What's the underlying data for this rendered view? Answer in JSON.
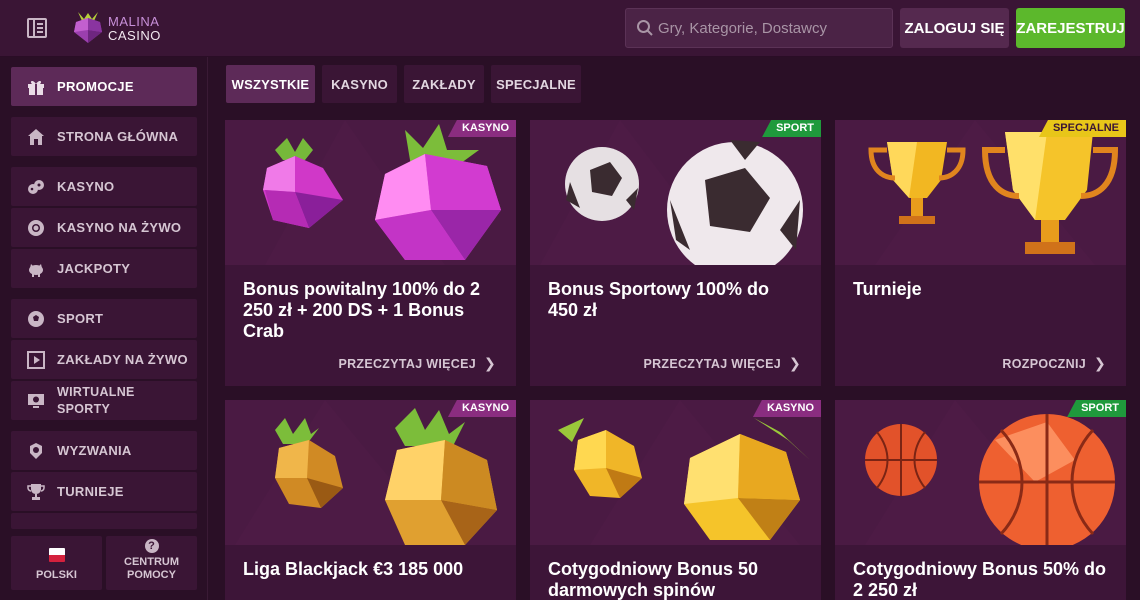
{
  "header": {
    "logo_line1": "MALINA",
    "logo_line2": "CASINO",
    "search_placeholder": "Gry, Kategorie, Dostawcy",
    "login_label": "ZALOGUJ SIĘ",
    "register_label": "ZAREJESTRUJ"
  },
  "sidebar": {
    "items": [
      {
        "label": "PROMOCJE",
        "icon": "gift-icon"
      },
      {
        "label": "STRONA GŁÓWNA",
        "icon": "home-icon"
      },
      {
        "label": "KASYNO",
        "icon": "dice-icon"
      },
      {
        "label": "KASYNO NA ŻYWO",
        "icon": "chip-icon"
      },
      {
        "label": "JACKPOTY",
        "icon": "pig-icon"
      },
      {
        "label": "SPORT",
        "icon": "ball-icon"
      },
      {
        "label": "ZAKŁADY NA ŻYWO",
        "icon": "live-icon"
      },
      {
        "label_line1": "WIRTUALNE",
        "label_line2": "SPORTY",
        "icon": "monitor-icon"
      },
      {
        "label": "WYZWANIA",
        "icon": "badge-icon"
      },
      {
        "label": "TURNIEJE",
        "icon": "trophy-icon"
      }
    ],
    "language_label": "POLSKI",
    "help_line1": "CENTRUM",
    "help_line2": "POMOCY"
  },
  "tabs": [
    "WSZYSTKIE",
    "KASYNO",
    "ZAKŁADY",
    "SPECJALNE"
  ],
  "cards": [
    {
      "badge": "KASYNO",
      "title": "Bonus powitalny 100% do 2 250 zł + 200 DS + 1 Bonus Crab",
      "cta": "PRZECZYTAJ WIĘCEJ"
    },
    {
      "badge": "SPORT",
      "title": "Bonus Sportowy 100% do 450 zł",
      "cta": "PRZECZYTAJ WIĘCEJ"
    },
    {
      "badge": "SPECJALNE",
      "title": "Turnieje",
      "cta": "ROZPOCZNIJ"
    },
    {
      "badge": "KASYNO",
      "title": "Liga Blackjack €3 185 000",
      "cta": ""
    },
    {
      "badge": "KASYNO",
      "title": "Cotygodniowy Bonus 50 darmowych spinów",
      "cta": ""
    },
    {
      "badge": "SPORT",
      "title": "Cotygodniowy Bonus 50% do 2 250 zł",
      "cta": ""
    }
  ],
  "colors": {
    "kasyno_badge": "#8a2d80",
    "sport_badge": "#1f9a3c",
    "specjalne_badge": "#e8c619",
    "register": "#5cb82c"
  }
}
